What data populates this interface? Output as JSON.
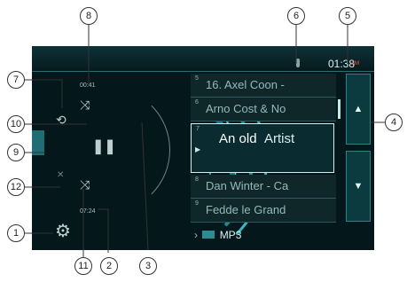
{
  "status_bar": {
    "time": "01:38",
    "ampm": "AM"
  },
  "player": {
    "elapsed": "00:41",
    "total": "07:24"
  },
  "tracks": [
    {
      "number": "5",
      "title": "16. Axel Coon -"
    },
    {
      "number": "6",
      "title": "Arno Cost & No"
    },
    {
      "number": "7",
      "title": "An old",
      "artist": "Artist"
    },
    {
      "number": "8",
      "title": "Dan Winter - Ca"
    },
    {
      "number": "9",
      "title": "Fedde le Grand"
    }
  ],
  "breadcrumb": {
    "folder": "MP3"
  },
  "callouts": [
    "1",
    "2",
    "3",
    "4",
    "5",
    "6",
    "7",
    "8",
    "9",
    "10",
    "11",
    "12"
  ],
  "colors": {
    "screen_bg": "#04171a",
    "accent": "#1fb3bd",
    "selected_border": "#d9eef0",
    "ampm": "#ff5a3a"
  }
}
